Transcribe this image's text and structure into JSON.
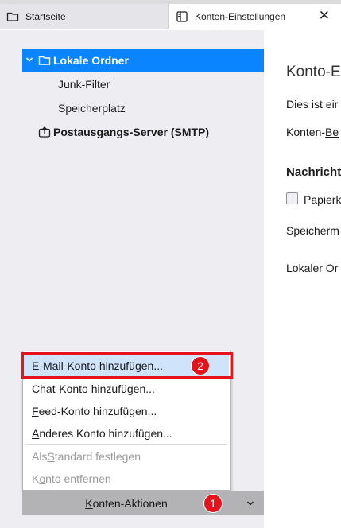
{
  "tabs": [
    {
      "label": "Startseite",
      "icon": "folder-icon",
      "active": false
    },
    {
      "label": "Konten-Einstellungen",
      "icon": "settings-page-icon",
      "active": true,
      "close_glyph": "✕"
    }
  ],
  "sidebar": {
    "tree": [
      {
        "label": "Lokale Ordner",
        "icon": "folder-icon",
        "expanded": true,
        "selected": true
      },
      {
        "label": "Junk-Filter"
      },
      {
        "label": "Speicherplatz"
      },
      {
        "label": "Postausgangs-Server (SMTP)",
        "icon": "outgoing-server-icon"
      }
    ]
  },
  "menu": {
    "items": [
      {
        "label": "E-Mail-Konto hinzufügen...",
        "accesskey": "E",
        "enabled": true,
        "highlighted": true
      },
      {
        "label": "Chat-Konto hinzufügen...",
        "accesskey": "C",
        "enabled": true
      },
      {
        "label": "Feed-Konto hinzufügen...",
        "accesskey": "F",
        "enabled": true
      },
      {
        "label": "Anderes Konto hinzufügen...",
        "accesskey": "A",
        "enabled": true
      },
      {
        "label": "Als Standard festlegen",
        "accesskey": "S",
        "enabled": false
      },
      {
        "label": "Konto entfernen",
        "accesskey": "o",
        "enabled": false
      }
    ]
  },
  "actions": {
    "label": "Konten-Aktionen",
    "accesskey": "K",
    "chevron": "⌄"
  },
  "badges": [
    "1",
    "2"
  ],
  "content": {
    "title": "Konto-E",
    "intro": "Dies ist eir",
    "account_name_prefix": "Konten-",
    "account_name_rest": "Be",
    "messages_heading": "Nachricht",
    "checkbox_label": "Papierk",
    "storage_label": "Speicherm",
    "local_dir_label": "Lokaler Or"
  },
  "colors": {
    "accent": "#0a84ff",
    "annotation": "#e3141b",
    "menu_hover": "#cfe3fb"
  }
}
